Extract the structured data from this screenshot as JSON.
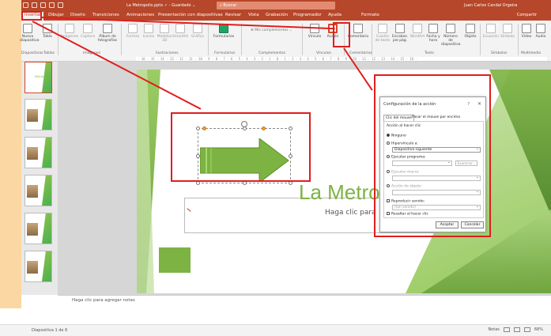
{
  "window": {
    "title": "La Metropolis.pptx  ✓  -  Guardado  ⌄",
    "search_placeholder": "Buscar",
    "user": "Juan Carlos Candal Orgeira",
    "share": "Compartir"
  },
  "tabs": [
    "Insertar",
    "Dibujar",
    "Diseño",
    "Transiciones",
    "Animaciones",
    "Presentación con diapositivas",
    "Revisar",
    "Vista",
    "Grabación",
    "Programador",
    "Ayuda",
    "Formato"
  ],
  "ribbon": {
    "buttons": {
      "nueva": "Nueva diapositiva",
      "tabla": "Tabla",
      "imagenes": "Imágenes",
      "captura": "Captura",
      "album": "Álbum de fotografías",
      "formas": "Formas",
      "iconos": "Iconos",
      "modelos": "Modelos 3D",
      "smartart": "SmartArt",
      "grafico": "Gráfico",
      "formularios": "Formularios",
      "vinculo": "Vínculo",
      "accion": "Acción",
      "comentario": "Comentario",
      "cuadro": "Cuadro de texto",
      "encabezado": "Encabez. pie pág.",
      "wordart": "WordArt",
      "fecha": "Fecha y hora",
      "numero": "Número de diapositiva",
      "objeto": "Objeto",
      "ecuacion": "Ecuación",
      "simbolo": "Símbolo",
      "video": "Vídeo",
      "audio": "Audio"
    },
    "complementos_btn": "Mis complementos",
    "groups": {
      "diapositivas": "Diapositivas",
      "tablas": "Tablas",
      "imagenes": "Imágenes",
      "ilustraciones": "Ilustraciones",
      "formularios": "Formularios",
      "complementos": "Complementos",
      "vinculos": "Vínculos",
      "comentarios": "Comentarios",
      "texto": "Texto",
      "simbolos": "Símbolos",
      "multimedia": "Multimedia"
    }
  },
  "ruler_text": "· 16 · 15 · 14 · 13 · 12 · 11 · 10 · 9 · 8 · 7 · 6 · 5 · 4 · 3 · 2 · 1 · 0 · 1 · 2 · 3 · 4 · 5 · 6 · 7 · 8 · 9 · 10 · 11 · 12 · 13 · 14 · 15 · 16 ·",
  "thumbnails": [
    {
      "num": "1",
      "text": "Metrópolis"
    },
    {
      "num": "2"
    },
    {
      "num": "3"
    },
    {
      "num": "4"
    },
    {
      "num": "5"
    },
    {
      "num": "6"
    }
  ],
  "slide": {
    "title": "La Metro",
    "subtitle": "Haga clic para"
  },
  "notes_placeholder": "Haga clic para agregar notas",
  "dialog": {
    "title": "Configuración de la acción",
    "help": "?",
    "close": "✕",
    "tabs": [
      "Clic del mouse",
      "Pasar el mouse por encima"
    ],
    "section": "Acción al hacer clic",
    "options": {
      "ninguno": "Ninguno",
      "hipervinculo": "Hipervínculo a:",
      "hipervinculo_value": "Diapositiva siguiente",
      "ejecutar_programa": "Ejecutar programa:",
      "examinar": "Examinar...",
      "ejecutar_macro": "Ejecutar macro:",
      "accion_objeto": "Acción de objeto:",
      "reproducir_sonido": "Reproducir sonido:",
      "sonido_value": "[Sin sonido]",
      "resaltar": "Resaltar al hacer clic"
    },
    "ok": "Aceptar",
    "cancel": "Cancelar"
  },
  "status": {
    "slide": "Diapositiva 1 de 6",
    "notes": "Notas",
    "zoom": "68%"
  }
}
